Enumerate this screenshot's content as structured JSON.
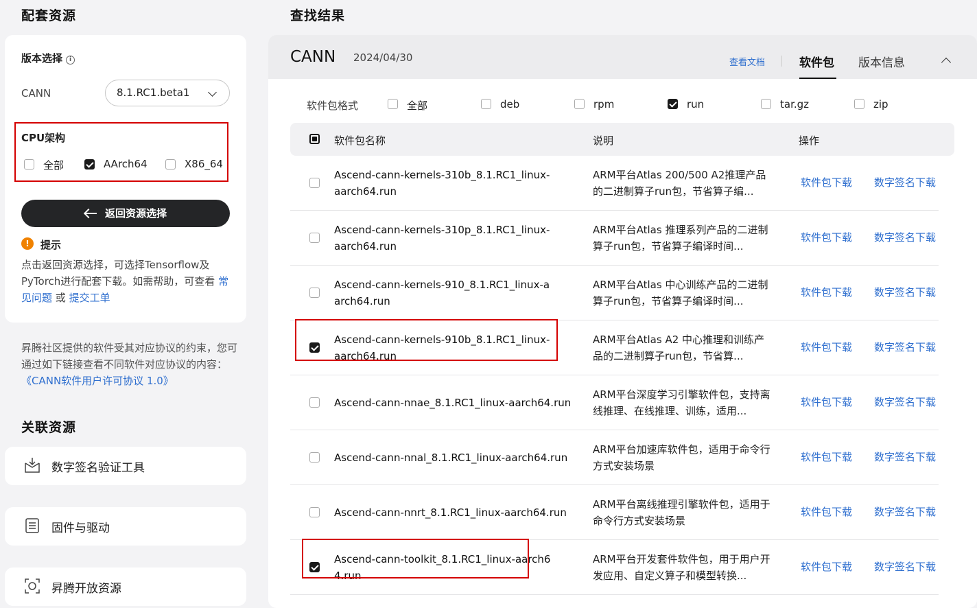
{
  "left": {
    "title": "配套资源",
    "version_label": "版本选择",
    "info_icon": "ⓘ",
    "product_label": "CANN",
    "version_value": "8.1.RC1.beta1",
    "cpu_label": "CPU架构",
    "cpu_options": [
      {
        "label": "全部",
        "checked": false
      },
      {
        "label": "AArch64",
        "checked": true
      },
      {
        "label": "X86_64",
        "checked": false
      }
    ],
    "back_button": "返回资源选择",
    "tip_title": "提示",
    "tip_text": "点击返回资源选择，可选择Tensorflow及PyTorch进行配套下载。如需帮助，可查看",
    "tip_link1": "常见问题",
    "tip_or": "或",
    "tip_link2": "提交工单",
    "license_text": "昇腾社区提供的软件受其对应协议的约束，您可通过如下链接查看不同软件对应协议的内容：",
    "license_link": "《CANN软件用户许可协议 1.0》",
    "related_title": "关联资源",
    "related": [
      {
        "label": "数字签名验证工具",
        "icon": "signature-tool-icon"
      },
      {
        "label": "固件与驱动",
        "icon": "firmware-icon"
      },
      {
        "label": "昇腾开放资源",
        "icon": "open-resource-icon"
      }
    ]
  },
  "right": {
    "title": "查找结果",
    "product": "CANN",
    "date": "2024/04/30",
    "doc_link": "查看文档",
    "tabs": [
      "软件包",
      "版本信息"
    ],
    "format_label": "软件包格式",
    "formats": [
      {
        "label": "全部",
        "checked": false
      },
      {
        "label": "deb",
        "checked": false
      },
      {
        "label": "rpm",
        "checked": false
      },
      {
        "label": "run",
        "checked": true
      },
      {
        "label": "tar.gz",
        "checked": false
      },
      {
        "label": "zip",
        "checked": false
      }
    ],
    "columns": [
      "软件包名称",
      "说明",
      "操作"
    ],
    "action_download": "软件包下载",
    "action_signature": "数字签名下载",
    "rows": [
      {
        "name": "Ascend-cann-kernels-310b_8.1.RC1_linux-aarch64.run",
        "desc": "ARM平台Atlas 200/500 A2推理产品的二进制算子run包，节省算子编...",
        "checked": false,
        "highlight": false
      },
      {
        "name": "Ascend-cann-kernels-310p_8.1.RC1_linux-aarch64.run",
        "desc": "ARM平台Atlas 推理系列产品的二进制算子run包，节省算子编译时间...",
        "checked": false,
        "highlight": false
      },
      {
        "name": "Ascend-cann-kernels-910_8.1.RC1_linux-aarch64.run",
        "desc": "ARM平台Atlas 中心训练产品的二进制算子run包，节省算子编译时间...",
        "checked": false,
        "highlight": false
      },
      {
        "name": "Ascend-cann-kernels-910b_8.1.RC1_linux-aarch64.run",
        "desc": "ARM平台Atlas A2 中心推理和训练产品的二进制算子run包，节省算...",
        "checked": true,
        "highlight": true
      },
      {
        "name": "Ascend-cann-nnae_8.1.RC1_linux-aarch64.run",
        "desc": "ARM平台深度学习引擎软件包，支持离线推理、在线推理、训练，适用...",
        "checked": false,
        "highlight": false
      },
      {
        "name": "Ascend-cann-nnal_8.1.RC1_linux-aarch64.run",
        "desc": "ARM平台加速库软件包，适用于命令行方式安装场景",
        "checked": false,
        "highlight": false
      },
      {
        "name": "Ascend-cann-nnrt_8.1.RC1_linux-aarch64.run",
        "desc": "ARM平台离线推理引擎软件包，适用于命令行方式安装场景",
        "checked": false,
        "highlight": false
      },
      {
        "name": "Ascend-cann-toolkit_8.1.RC1_linux-aarch64.run",
        "desc": "ARM平台开发套件软件包，用于用户开发应用、自定义算子和模型转换...",
        "checked": true,
        "highlight": true
      }
    ]
  },
  "colors": {
    "accent_link": "#2f6fcf",
    "highlight_box": "#d40000",
    "warning": "#f08200",
    "dark_button": "#242527"
  }
}
